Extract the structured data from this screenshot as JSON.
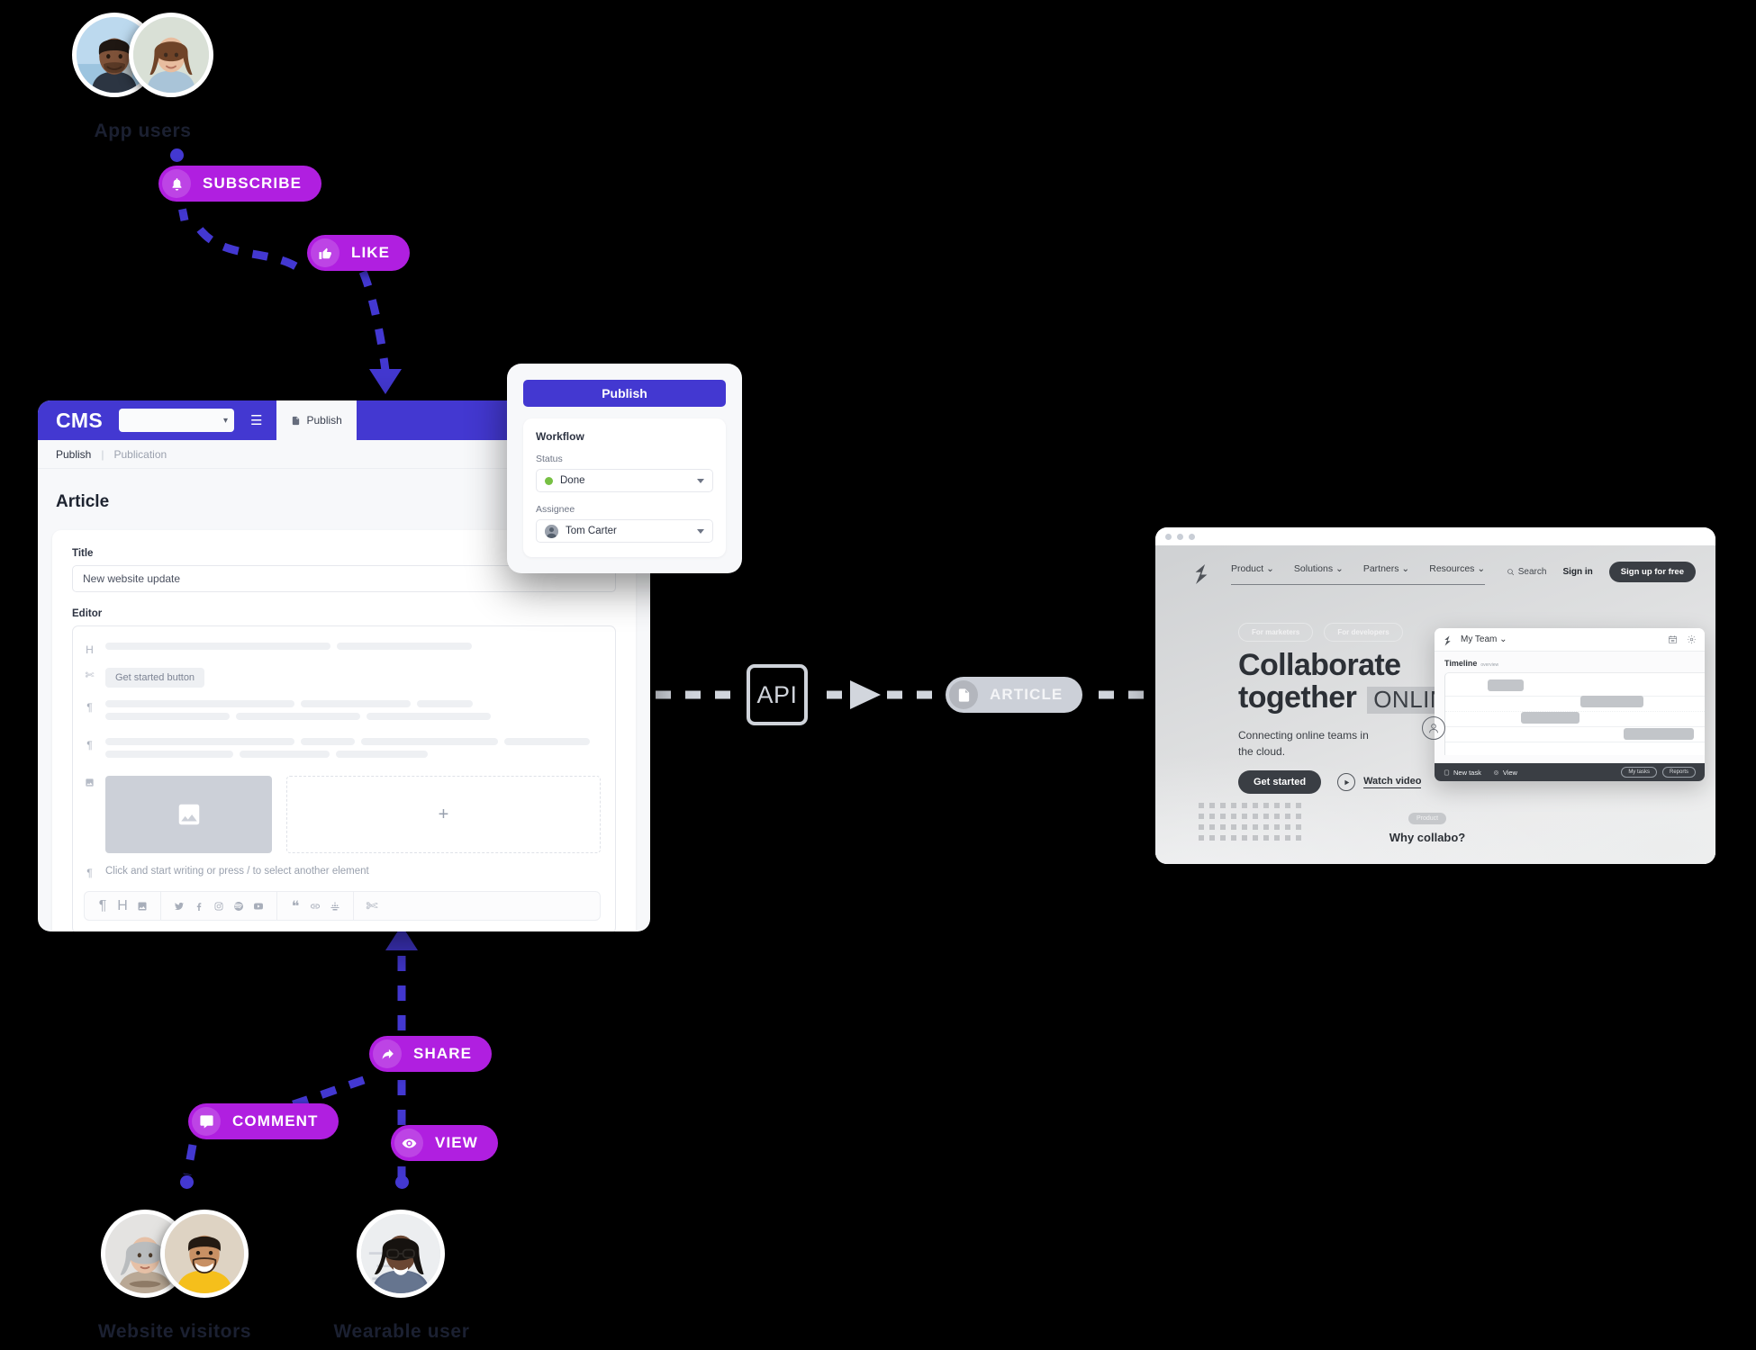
{
  "personas": {
    "app_users": "App users",
    "website_visitors": "Website visitors",
    "wearable_user": "Wearable user"
  },
  "actions": {
    "subscribe": {
      "label": "SUBSCRIBE",
      "icon": "bell-icon"
    },
    "like": {
      "label": "LIKE",
      "icon": "thumbs-up-icon"
    },
    "share": {
      "label": "SHARE",
      "icon": "share-icon"
    },
    "comment": {
      "label": "COMMENT",
      "icon": "comment-icon"
    },
    "view": {
      "label": "VIEW",
      "icon": "eye-icon"
    },
    "article": {
      "label": "ARTICLE",
      "icon": "document-icon"
    }
  },
  "api": {
    "label": "API"
  },
  "cms": {
    "logo": "CMS",
    "tab_label": "Publish",
    "breadcrumb": {
      "current": "Publish",
      "parent": "Publication"
    },
    "page_title": "Article",
    "fields": {
      "title_label": "Title",
      "title_value": "New website update",
      "editor_label": "Editor"
    },
    "editor": {
      "chip_button": "Get started button",
      "placeholder": "Click and start writing or press / to select another element",
      "add_block": "+",
      "toolbar_icons": [
        "paragraph-icon",
        "heading-icon",
        "image-icon",
        "twitter-icon",
        "facebook-icon",
        "instagram-icon",
        "spotify-icon",
        "youtube-icon",
        "quote-icon",
        "link-icon",
        "embed-icon",
        "code-icon"
      ]
    }
  },
  "publish_panel": {
    "button": "Publish",
    "section_title": "Workflow",
    "status_label": "Status",
    "status_value": "Done",
    "status_color": "#77c043",
    "assignee_label": "Assignee",
    "assignee_value": "Tom Carter"
  },
  "site": {
    "nav": [
      "Product",
      "Solutions",
      "Partners",
      "Resources"
    ],
    "search": "Search",
    "sign_in": "Sign in",
    "sign_up": "Sign up for free",
    "tags": [
      "For marketers",
      "For developers"
    ],
    "headline_line1": "Collaborate",
    "headline_line2": "together",
    "headline_highlight": "ONLINE",
    "subhead": "Connecting online teams in\nthe cloud.",
    "cta_primary": "Get started",
    "cta_secondary": "Watch video",
    "why_pill": "Product",
    "why_title": "Why collabo?"
  },
  "app_card": {
    "team": "My Team",
    "timeline_title": "Timeline",
    "timeline_sub": "overview",
    "footer_new_task": "New task",
    "footer_view": "View",
    "footer_my_tasks": "My tasks",
    "footer_reports": "Reports"
  },
  "colors": {
    "accent_purple": "#b01fe0",
    "accent_indigo": "#4338d1",
    "status_green": "#77c043",
    "label_dark": "#1b2031",
    "light_pill": "#ccd0d8"
  }
}
